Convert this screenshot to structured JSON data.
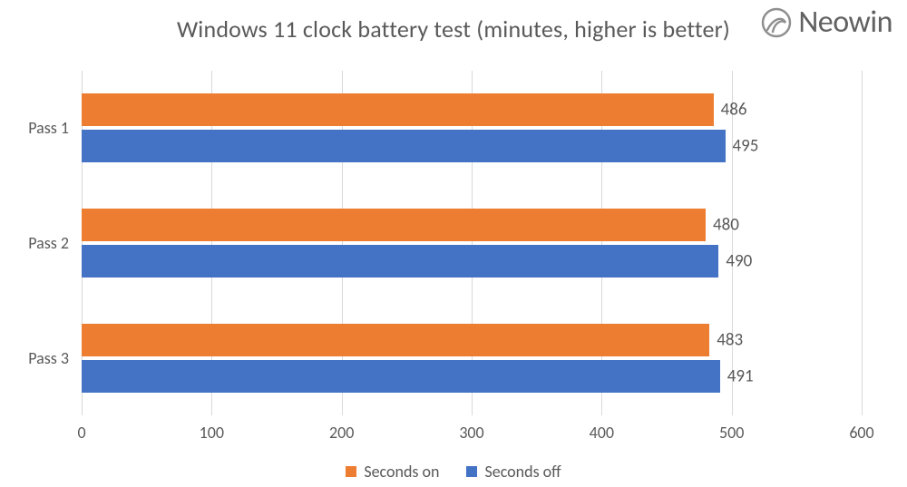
{
  "title": "Windows 11 clock battery test (minutes, higher is better)",
  "watermark": "Neowin",
  "colors": {
    "on": "#ed7d31",
    "off": "#4472c4"
  },
  "legend": {
    "on": "Seconds on",
    "off": "Seconds off"
  },
  "x_ticks": [
    0,
    100,
    200,
    300,
    400,
    500,
    600
  ],
  "chart_data": {
    "type": "bar",
    "orientation": "horizontal",
    "title": "Windows 11 clock battery test (minutes, higher is better)",
    "xlabel": "",
    "ylabel": "",
    "xlim": [
      0,
      600
    ],
    "categories": [
      "Pass 1",
      "Pass 2",
      "Pass 3"
    ],
    "series": [
      {
        "name": "Seconds on",
        "values": [
          486,
          480,
          483
        ],
        "color": "#ed7d31"
      },
      {
        "name": "Seconds off",
        "values": [
          495,
          490,
          491
        ],
        "color": "#4472c4"
      }
    ],
    "legend_position": "bottom",
    "grid": {
      "x": true,
      "y": false
    }
  }
}
